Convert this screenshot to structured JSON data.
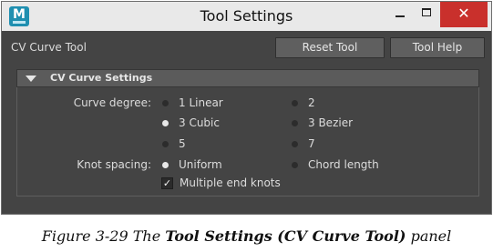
{
  "window": {
    "app_icon_letter": "M",
    "title": "Tool Settings",
    "close_glyph": "✕"
  },
  "header": {
    "tool_name": "CV Curve Tool",
    "reset_label": "Reset Tool",
    "help_label": "Tool Help"
  },
  "section": {
    "title": "CV Curve Settings",
    "expanded": true
  },
  "curve_degree": {
    "label": "Curve degree:",
    "options": [
      {
        "label": "1 Linear",
        "selected": false
      },
      {
        "label": "2",
        "selected": false
      },
      {
        "label": "3 Cubic",
        "selected": true
      },
      {
        "label": "3 Bezier",
        "selected": false
      },
      {
        "label": "5",
        "selected": false
      },
      {
        "label": "7",
        "selected": false
      }
    ]
  },
  "knot_spacing": {
    "label": "Knot spacing:",
    "options": [
      {
        "label": "Uniform",
        "selected": true
      },
      {
        "label": "Chord length",
        "selected": false
      }
    ]
  },
  "multiple_end_knots": {
    "label": "Multiple end knots",
    "checked": true,
    "check_glyph": "✓"
  },
  "caption": {
    "prefix": "Figure 3-29  The ",
    "bold": "Tool Settings (CV Curve Tool)",
    "suffix": " panel"
  }
}
